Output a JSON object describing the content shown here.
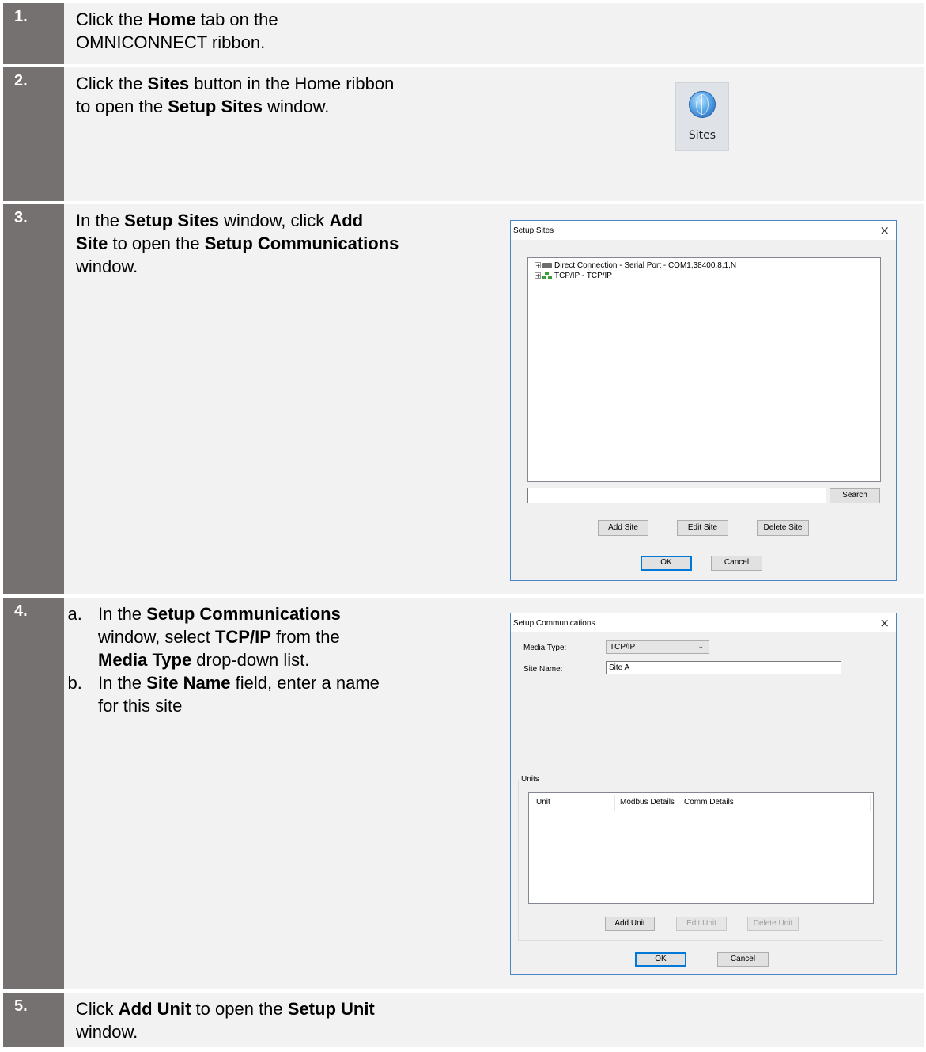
{
  "steps": [
    {
      "number": "1.",
      "segments": [
        {
          "t": "Click the ",
          "b": false
        },
        {
          "t": "Home",
          "b": true
        },
        {
          "t": " tab on the",
          "b": false
        },
        {
          "br": true
        },
        {
          "t": "OMNICONNECT ribbon.",
          "b": false
        }
      ]
    },
    {
      "number": "2.",
      "segments": [
        {
          "t": "Click the ",
          "b": false
        },
        {
          "t": "Sites",
          "b": true
        },
        {
          "t": " button in the Home ribbon",
          "b": false
        },
        {
          "br": true
        },
        {
          "t": "to open the ",
          "b": false
        },
        {
          "t": "Setup Sites",
          "b": true
        },
        {
          "t": " window.",
          "b": false
        }
      ]
    },
    {
      "number": "3.",
      "segments": [
        {
          "t": "In the ",
          "b": false
        },
        {
          "t": "Setup Sites",
          "b": true
        },
        {
          "t": " window, click ",
          "b": false
        },
        {
          "t": "Add",
          "b": true
        },
        {
          "br": true
        },
        {
          "t": "Site",
          "b": true
        },
        {
          "t": " to open the ",
          "b": false
        },
        {
          "t": "Setup Communications",
          "b": true
        },
        {
          "br": true
        },
        {
          "t": "window.",
          "b": false
        }
      ]
    },
    {
      "number": "4.",
      "sub_items": [
        [
          {
            "t": "In the ",
            "b": false
          },
          {
            "t": "Setup Communications",
            "b": true
          },
          {
            "br": true
          },
          {
            "t": "window, select ",
            "b": false
          },
          {
            "t": "TCP/IP",
            "b": true
          },
          {
            "t": " from the",
            "b": false
          },
          {
            "br": true
          },
          {
            "t": "Media Type",
            "b": true
          },
          {
            "t": " drop-down list.",
            "b": false
          }
        ],
        [
          {
            "t": "In the ",
            "b": false
          },
          {
            "t": "Site Name",
            "b": true
          },
          {
            "t": " field, enter a name",
            "b": false
          },
          {
            "br": true
          },
          {
            "t": "for this site",
            "b": false
          }
        ]
      ]
    },
    {
      "number": "5.",
      "segments": [
        {
          "t": "Click ",
          "b": false
        },
        {
          "t": "Add Unit",
          "b": true
        },
        {
          "t": " to open the ",
          "b": false
        },
        {
          "t": "Setup Unit",
          "b": true
        },
        {
          "br": true
        },
        {
          "t": "window.",
          "b": false
        }
      ]
    }
  ],
  "sites_button": {
    "label": "Sites",
    "icon": "globe-icon"
  },
  "setup_sites": {
    "title": "Setup Sites",
    "close": "×",
    "tree": [
      {
        "label": "Direct Connection - Serial Port - COM1,38400,8,1,N",
        "icon": "serial-port-icon"
      },
      {
        "label": "TCP/IP - TCP/IP",
        "icon": "network-icon"
      }
    ],
    "search_value": "",
    "search_button": "Search",
    "add_site": "Add Site",
    "edit_site": "Edit Site",
    "delete_site": "Delete Site",
    "ok": "OK",
    "cancel": "Cancel"
  },
  "setup_comms": {
    "title": "Setup Communications",
    "close": "×",
    "media_type_label": "Media Type:",
    "media_type_value": "TCP/IP",
    "site_name_label": "Site Name:",
    "site_name_value": "Site A",
    "units_group": "Units",
    "columns": [
      "Unit",
      "Modbus Details",
      "Comm Details"
    ],
    "add_unit": "Add Unit",
    "edit_unit": "Edit Unit",
    "delete_unit": "Delete Unit",
    "ok": "OK",
    "cancel": "Cancel"
  }
}
